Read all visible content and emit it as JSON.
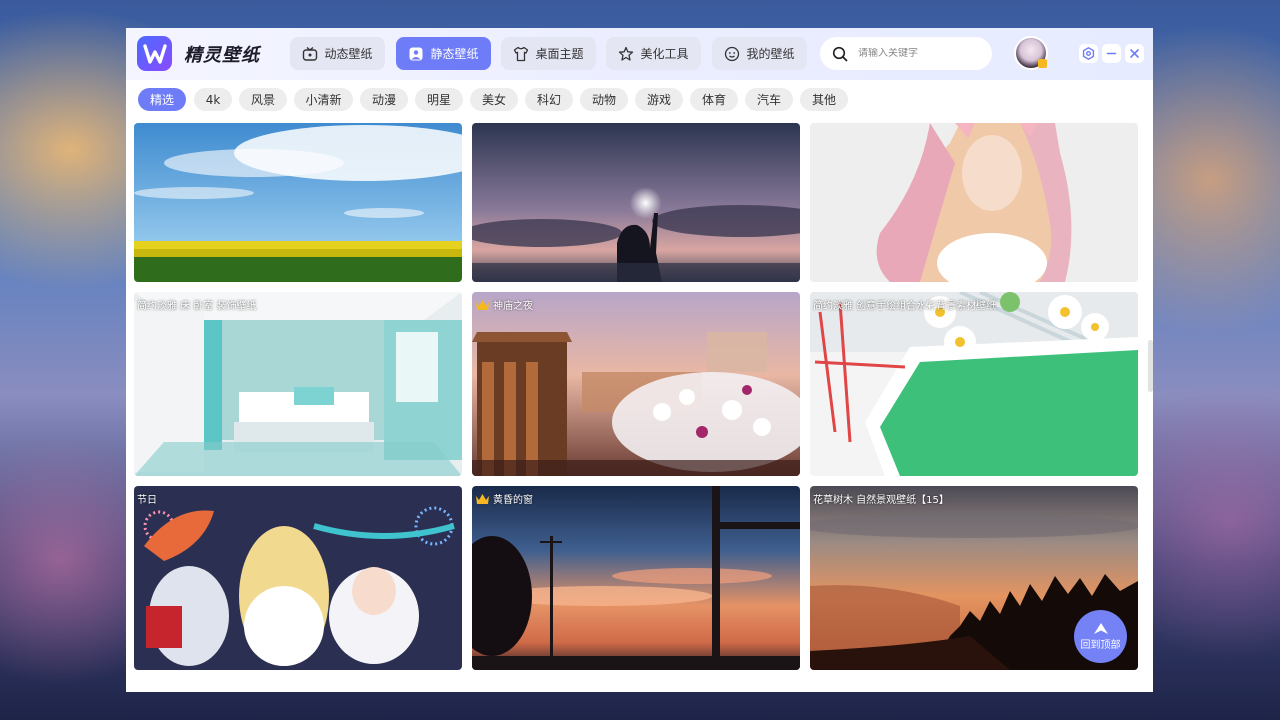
{
  "app": {
    "title": "精灵壁纸",
    "nav": [
      {
        "label": "动态壁纸",
        "icon": "tv-icon",
        "active": false
      },
      {
        "label": "静态壁纸",
        "icon": "image-icon",
        "active": true
      },
      {
        "label": "桌面主题",
        "icon": "shirt-icon",
        "active": false
      },
      {
        "label": "美化工具",
        "icon": "tools-icon",
        "active": false
      },
      {
        "label": "我的壁纸",
        "icon": "smile-icon",
        "active": false
      }
    ],
    "search": {
      "placeholder": "请输入关键字",
      "value": ""
    }
  },
  "window_controls": [
    "settings-icon",
    "minimize-icon",
    "close-icon"
  ],
  "categories": {
    "items": [
      "精选",
      "4k",
      "风景",
      "小清新",
      "动漫",
      "明星",
      "美女",
      "科幻",
      "动物",
      "游戏",
      "体育",
      "汽车",
      "其他"
    ],
    "active": "精选"
  },
  "wallpapers": [
    {
      "label": "",
      "crown": false,
      "subject": "sky over yellow flower field"
    },
    {
      "label": "",
      "crown": false,
      "subject": "girl silhouette with sparkler at dusk"
    },
    {
      "label": "",
      "crown": false,
      "subject": "anime girl with pink hair and fox ears"
    },
    {
      "label": "简约淡雅 床 卧室 装饰壁纸",
      "crown": false,
      "subject": "teal bedroom interior"
    },
    {
      "label": "神庙之夜",
      "crown": true,
      "subject": "ancient temple ruins with white flowers"
    },
    {
      "label": "简约淡雅 创意手绘组合水彩背景素材壁纸",
      "crown": false,
      "subject": "green canvas with brushes and daisies"
    },
    {
      "label": "节日",
      "crown": false,
      "subject": "anime characters celebrating with fireworks"
    },
    {
      "label": "黄昏的窗",
      "crown": true,
      "subject": "sunset sky through window frame"
    },
    {
      "label": "花草树木 自然景观壁纸【15】",
      "crown": false,
      "subject": "pine forest silhouette at sunset"
    }
  ],
  "back_to_top": {
    "label": "回到顶部",
    "icon": "arrow-up-icon"
  },
  "colors": {
    "accent": "#6e7cf8",
    "chip_bg": "#ededed",
    "nav_bg": "#e4e6f3",
    "crown": "#f5b820"
  }
}
